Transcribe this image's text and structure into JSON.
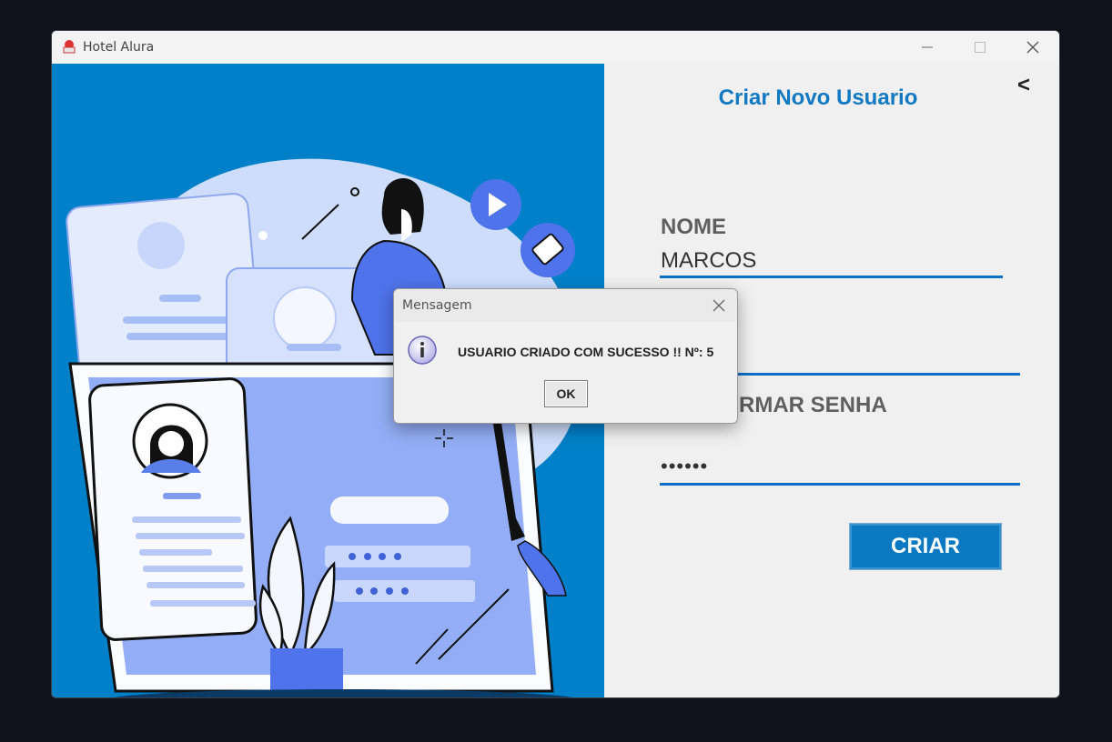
{
  "window": {
    "title": "Hotel Alura"
  },
  "form": {
    "title": "Criar Novo Usuario",
    "back_label": "<",
    "name_label": "NOME",
    "name_value": "MARCOS",
    "confirm_label_visible": "RMAR SENHA",
    "confirm_value": "••••••",
    "submit_label": "CRIAR"
  },
  "dialog": {
    "title": "Mensagem",
    "message": "USUARIO CRIADO COM SUCESSO !! Nº: 5",
    "ok_label": "OK",
    "icon": "info-icon"
  },
  "colors": {
    "accent_blue": "#0080c8",
    "title_blue": "#1279c2",
    "button_blue": "#0b79c1"
  }
}
